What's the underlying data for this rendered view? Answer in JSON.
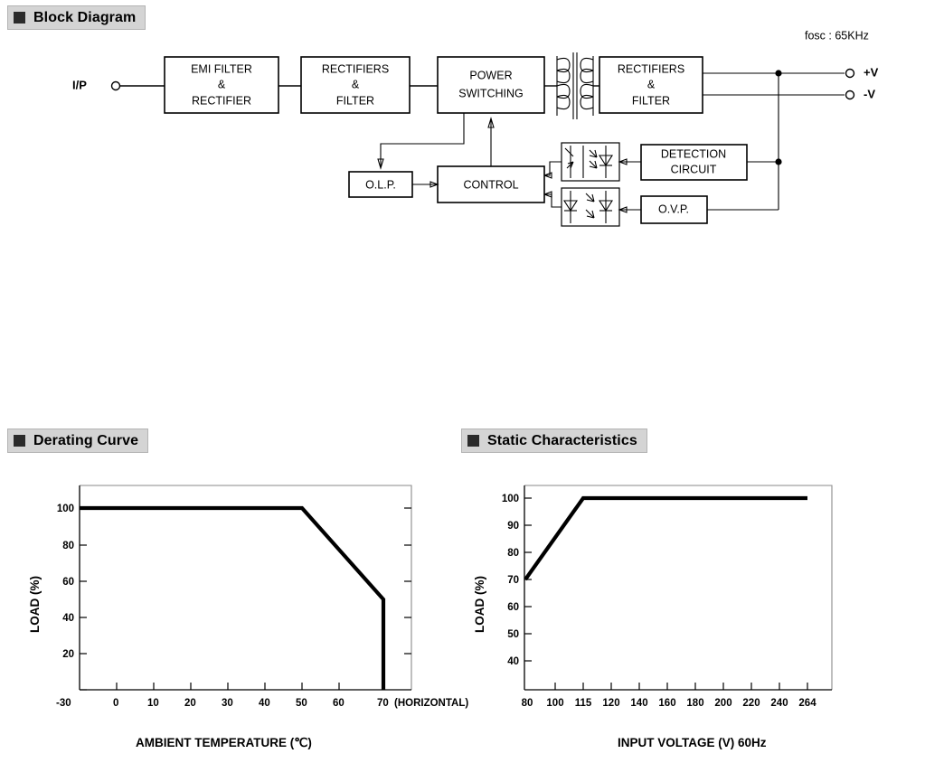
{
  "sections": {
    "block_diagram": {
      "title": "Block Diagram",
      "note": "fosc : 65KHz",
      "input_label": "I/P",
      "output_labels": {
        "positive": "+V",
        "negative": "-V"
      },
      "blocks": [
        {
          "id": "emi",
          "lines": [
            "EMI  FILTER",
            "&",
            "RECTIFIER"
          ]
        },
        {
          "id": "rect1",
          "lines": [
            "RECTIFIERS",
            "&",
            "FILTER"
          ]
        },
        {
          "id": "power",
          "lines": [
            "POWER",
            "SWITCHING"
          ]
        },
        {
          "id": "rect2",
          "lines": [
            "RECTIFIERS",
            "&",
            "FILTER"
          ]
        },
        {
          "id": "olp",
          "lines": [
            "O.L.P."
          ]
        },
        {
          "id": "control",
          "lines": [
            "CONTROL"
          ]
        },
        {
          "id": "detection",
          "lines": [
            "DETECTION",
            "CIRCUIT"
          ]
        },
        {
          "id": "ovp",
          "lines": [
            "O.V.P."
          ]
        }
      ]
    },
    "derating_curve": {
      "title": "Derating Curve"
    },
    "static_characteristics": {
      "title": "Static Characteristics"
    }
  },
  "chart_data": [
    {
      "id": "derating",
      "type": "line",
      "title": "Derating Curve",
      "xlabel": "AMBIENT TEMPERATURE (℃)",
      "ylabel": "LOAD (%)",
      "annotation": "(HORIZONTAL)",
      "xticks": [
        -30,
        0,
        10,
        20,
        30,
        40,
        50,
        60,
        70
      ],
      "xticklabels": [
        "-30",
        "0",
        "10",
        "20",
        "30",
        "40",
        "50",
        "60",
        "70"
      ],
      "yticks": [
        20,
        40,
        60,
        80,
        100
      ],
      "yticklabels": [
        "20",
        "40",
        "60",
        "80",
        "100"
      ],
      "xlim": [
        -30,
        75
      ],
      "ylim": [
        0,
        110
      ],
      "grid": false,
      "legend": "none",
      "x": [
        -30,
        50,
        70,
        70
      ],
      "y": [
        100,
        100,
        50,
        0
      ],
      "points": [
        {
          "x": -30,
          "y": 100
        },
        {
          "x": 50,
          "y": 100
        },
        {
          "x": 70,
          "y": 50
        },
        {
          "x": 70,
          "y": 0
        }
      ]
    },
    {
      "id": "static",
      "type": "line",
      "title": "Static Characteristics",
      "xlabel": "INPUT VOLTAGE (V) 60Hz",
      "ylabel": "LOAD (%)",
      "xticks": [
        80,
        100,
        115,
        120,
        140,
        160,
        180,
        200,
        220,
        240,
        264
      ],
      "xticklabels": [
        "80",
        "100",
        "115",
        "120",
        "140",
        "160",
        "180",
        "200",
        "220",
        "240",
        "264"
      ],
      "yticks": [
        40,
        50,
        60,
        70,
        80,
        90,
        100
      ],
      "yticklabels": [
        "40",
        "50",
        "60",
        "70",
        "80",
        "90",
        "100"
      ],
      "xlim": [
        80,
        264
      ],
      "ylim": [
        30,
        108
      ],
      "grid": false,
      "legend": "none",
      "x": [
        80,
        115,
        264
      ],
      "y": [
        70,
        100,
        100
      ],
      "points": [
        {
          "x": 80,
          "y": 70
        },
        {
          "x": 115,
          "y": 100
        },
        {
          "x": 264,
          "y": 100
        }
      ]
    }
  ]
}
